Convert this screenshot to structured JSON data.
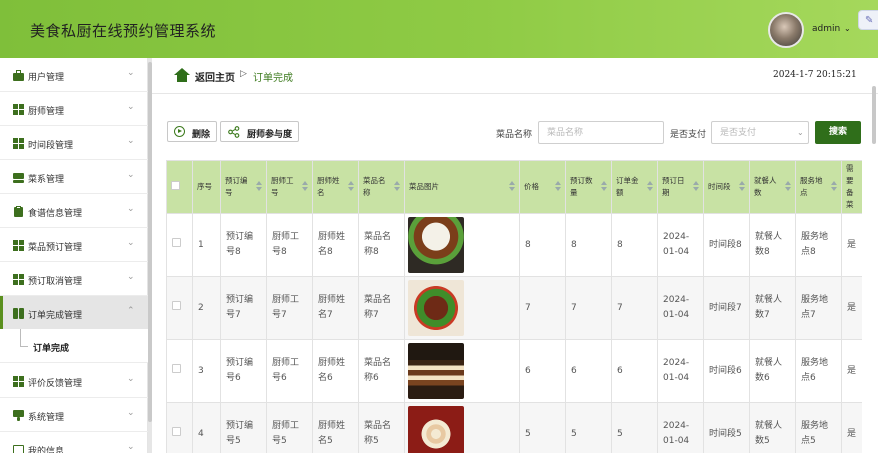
{
  "header": {
    "app_title": "美食私厨在线预约管理系统",
    "user_name": "admin",
    "user_caret": "⌄",
    "corner_glyph": "✎",
    "brand_color": "#8cc63f"
  },
  "sidebar": {
    "items": [
      {
        "label": "用户管理",
        "icon": "briefcase-icon"
      },
      {
        "label": "厨师管理",
        "icon": "grid-icon"
      },
      {
        "label": "时间段管理",
        "icon": "grid-icon"
      },
      {
        "label": "菜系管理",
        "icon": "tray-icon"
      },
      {
        "label": "食谱信息管理",
        "icon": "clipboard-icon"
      },
      {
        "label": "菜品预订管理",
        "icon": "grid-icon"
      },
      {
        "label": "预订取消管理",
        "icon": "grid-icon"
      },
      {
        "label": "订单完成管理",
        "icon": "columns-icon"
      },
      {
        "label": "评价反馈管理",
        "icon": "grid-icon"
      },
      {
        "label": "系统管理",
        "icon": "monitor-icon"
      },
      {
        "label": "我的信息",
        "icon": "card-icon"
      }
    ],
    "chevron": "⌄",
    "chevron_up": "⌃",
    "active_submenu": "订单完成"
  },
  "breadcrumb": {
    "home": "返回主页",
    "separator": "▷",
    "current": "订单完成",
    "datetime": "2024-1-7 20:15:21"
  },
  "toolbar": {
    "delete_label": "删除",
    "participation_label": "厨师参与度",
    "dish_name_label": "菜品名称",
    "dish_name_placeholder": "菜品名称",
    "paid_label": "是否支付",
    "paid_placeholder": "是否支付",
    "search_label": "搜索"
  },
  "table": {
    "columns": [
      "序号",
      "预订编号",
      "厨师工号",
      "厨师姓名",
      "菜品名称",
      "菜品图片",
      "价格",
      "预订数量",
      "订单金额",
      "预订日期",
      "时间段",
      "就餐人数",
      "服务地点",
      "需要备菜"
    ],
    "rows": [
      {
        "idx": "1",
        "order_no": "预订编号8",
        "chef_no": "厨师工号8",
        "chef_name": "厨师姓名8",
        "dish": "菜品名称8",
        "image": "steamed-bun-dish",
        "price": "8",
        "qty": "8",
        "amount": "8",
        "date": "2024-01-04",
        "slot": "时间段8",
        "people": "就餐人数8",
        "place": "服务地点8",
        "prep": "是"
      },
      {
        "idx": "2",
        "order_no": "预订编号7",
        "chef_no": "厨师工号7",
        "chef_name": "厨师姓名7",
        "dish": "菜品名称7",
        "image": "braised-pork-dish",
        "price": "7",
        "qty": "7",
        "amount": "7",
        "date": "2024-01-04",
        "slot": "时间段7",
        "people": "就餐人数7",
        "place": "服务地点7",
        "prep": "是"
      },
      {
        "idx": "3",
        "order_no": "预订编号6",
        "chef_no": "厨师工号6",
        "chef_name": "厨师姓名6",
        "dish": "菜品名称6",
        "image": "layer-cake-dish",
        "price": "6",
        "qty": "6",
        "amount": "6",
        "date": "2024-01-04",
        "slot": "时间段6",
        "people": "就餐人数6",
        "place": "服务地点6",
        "prep": "是"
      },
      {
        "idx": "4",
        "order_no": "预订编号5",
        "chef_no": "厨师工号5",
        "chef_name": "厨师姓名5",
        "dish": "菜品名称5",
        "image": "dumplings-dish",
        "price": "5",
        "qty": "5",
        "amount": "5",
        "date": "2024-01-04",
        "slot": "时间段5",
        "people": "就餐人数5",
        "place": "服务地点5",
        "prep": "是"
      }
    ]
  }
}
